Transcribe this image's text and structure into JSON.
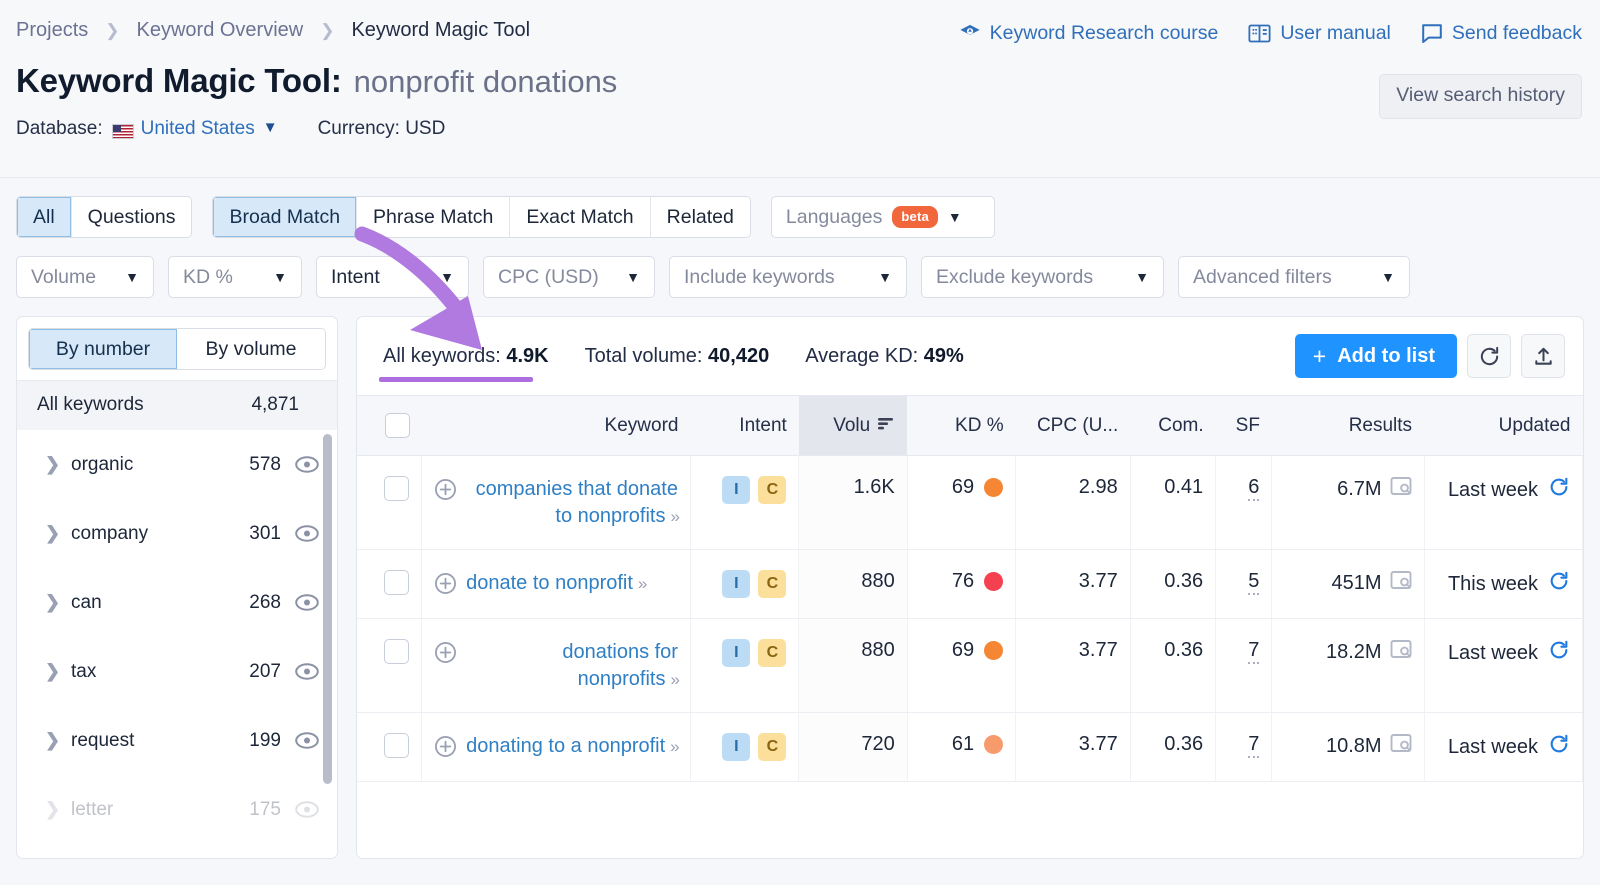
{
  "breadcrumb": [
    {
      "label": "Projects"
    },
    {
      "label": "Keyword Overview"
    },
    {
      "label": "Keyword Magic Tool"
    }
  ],
  "header": {
    "title": "Keyword Magic Tool:",
    "query": "nonprofit donations",
    "database_label": "Database:",
    "database_value": "United States",
    "currency_label": "Currency:",
    "currency_value": "USD",
    "currency_text": "Currency: USD",
    "flag_icon": "us-flag-icon",
    "links": [
      {
        "label": "Keyword Research course",
        "icon": "graduation-cap-icon"
      },
      {
        "label": "User manual",
        "icon": "book-icon"
      },
      {
        "label": "Send feedback",
        "icon": "speech-bubble-icon"
      }
    ],
    "search_history_button": "View search history"
  },
  "filters": {
    "match_group_a": [
      {
        "label": "All",
        "active": true
      },
      {
        "label": "Questions",
        "active": false
      }
    ],
    "match_group_b": [
      {
        "label": "Broad Match",
        "active": true
      },
      {
        "label": "Phrase Match",
        "active": false
      },
      {
        "label": "Exact Match",
        "active": false
      },
      {
        "label": "Related",
        "active": false
      }
    ],
    "languages": {
      "label": "Languages",
      "badge": "beta"
    },
    "dropdowns": [
      {
        "label": "Volume"
      },
      {
        "label": "KD %"
      },
      {
        "label": "Intent"
      },
      {
        "label": "CPC (USD)"
      },
      {
        "label": "Include keywords"
      },
      {
        "label": "Exclude keywords"
      },
      {
        "label": "Advanced filters"
      }
    ]
  },
  "sidebar": {
    "toggle": [
      {
        "label": "By number",
        "active": true
      },
      {
        "label": "By volume",
        "active": false
      }
    ],
    "all_keywords_label": "All keywords",
    "all_keywords_count": "4,871",
    "groups": [
      {
        "label": "organic",
        "count": "578"
      },
      {
        "label": "company",
        "count": "301"
      },
      {
        "label": "can",
        "count": "268"
      },
      {
        "label": "tax",
        "count": "207"
      },
      {
        "label": "request",
        "count": "199"
      },
      {
        "label": "letter",
        "count": "175"
      }
    ]
  },
  "stats": {
    "all_keywords": {
      "label": "All keywords:",
      "value": "4.9K"
    },
    "total_volume": {
      "label": "Total volume:",
      "value": "40,420"
    },
    "average_kd": {
      "label": "Average KD:",
      "value": "49%"
    },
    "add_to_list": "Add to list",
    "plus": "+",
    "refresh_icon": "refresh-icon",
    "export_icon": "export-icon"
  },
  "table": {
    "columns": [
      {
        "key": "keyword",
        "label": "Keyword"
      },
      {
        "key": "intent",
        "label": "Intent"
      },
      {
        "key": "volume",
        "label": "Volu",
        "sorted": true
      },
      {
        "key": "kd",
        "label": "KD %"
      },
      {
        "key": "cpc",
        "label": "CPC (U..."
      },
      {
        "key": "com",
        "label": "Com."
      },
      {
        "key": "sf",
        "label": "SF"
      },
      {
        "key": "results",
        "label": "Results"
      },
      {
        "key": "updated",
        "label": "Updated"
      }
    ],
    "rows": [
      {
        "keyword": "companies that donate to nonprofits",
        "intents": [
          "I",
          "C"
        ],
        "volume": "1.6K",
        "kd": "69",
        "kd_color": "#f58634",
        "cpc": "2.98",
        "com": "0.41",
        "sf": "6",
        "results": "6.7M",
        "updated": "Last week"
      },
      {
        "keyword": "donate to nonprofit",
        "intents": [
          "I",
          "C"
        ],
        "volume": "880",
        "kd": "76",
        "kd_color": "#f5414f",
        "cpc": "3.77",
        "com": "0.36",
        "sf": "5",
        "results": "451M",
        "updated": "This week"
      },
      {
        "keyword": "donations for nonprofits",
        "intents": [
          "I",
          "C"
        ],
        "volume": "880",
        "kd": "69",
        "kd_color": "#f58634",
        "cpc": "3.77",
        "com": "0.36",
        "sf": "7",
        "results": "18.2M",
        "updated": "Last week"
      },
      {
        "keyword": "donating to a nonprofit",
        "intents": [
          "I",
          "C"
        ],
        "volume": "720",
        "kd": "61",
        "kd_color": "#f89b6c",
        "cpc": "3.77",
        "com": "0.36",
        "sf": "7",
        "results": "10.8M",
        "updated": "Last week"
      }
    ]
  },
  "annotation": {
    "arrow_color": "#b07ae0",
    "underline_color": "#ad6ee0",
    "description": "purple curved arrow from Broad Match tab to All keywords stat"
  },
  "colors": {
    "accent_blue": "#1f93ff",
    "link_blue": "#2f7fc4",
    "tab_active_bg": "#d7e9f8",
    "beta_orange": "#f2663c"
  }
}
